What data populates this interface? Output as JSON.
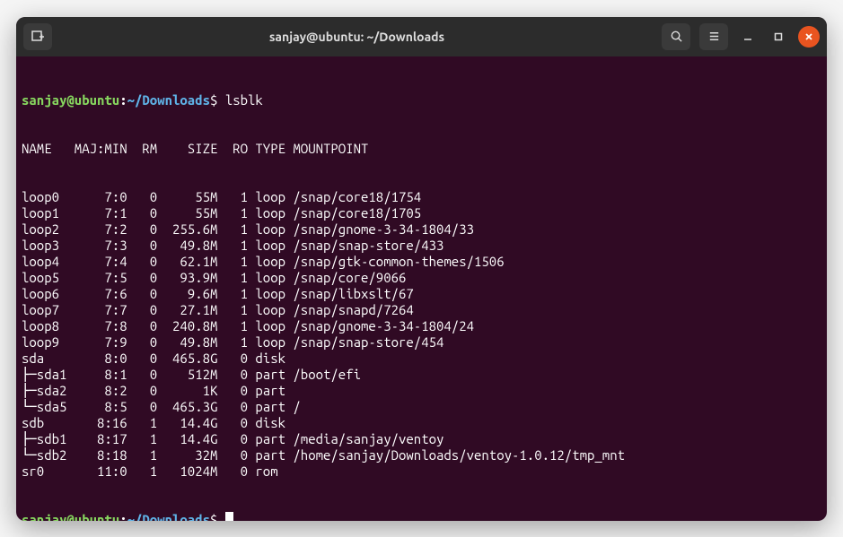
{
  "titlebar": {
    "title": "sanjay@ubuntu: ~/Downloads"
  },
  "prompt": {
    "userhost": "sanjay@ubuntu",
    "sep": ":",
    "path": "~/Downloads",
    "sigil": "$"
  },
  "command": "lsblk",
  "header": {
    "NAME": "NAME",
    "MAJMIN": "MAJ:MIN",
    "RM": "RM",
    "SIZE": "SIZE",
    "RO": "RO",
    "TYPE": "TYPE",
    "MOUNTPOINT": "MOUNTPOINT"
  },
  "rows": [
    {
      "tree": "",
      "name": "loop0",
      "majmin": "7:0",
      "rm": "0",
      "size": "55M",
      "ro": "1",
      "type": "loop",
      "mount": "/snap/core18/1754"
    },
    {
      "tree": "",
      "name": "loop1",
      "majmin": "7:1",
      "rm": "0",
      "size": "55M",
      "ro": "1",
      "type": "loop",
      "mount": "/snap/core18/1705"
    },
    {
      "tree": "",
      "name": "loop2",
      "majmin": "7:2",
      "rm": "0",
      "size": "255.6M",
      "ro": "1",
      "type": "loop",
      "mount": "/snap/gnome-3-34-1804/33"
    },
    {
      "tree": "",
      "name": "loop3",
      "majmin": "7:3",
      "rm": "0",
      "size": "49.8M",
      "ro": "1",
      "type": "loop",
      "mount": "/snap/snap-store/433"
    },
    {
      "tree": "",
      "name": "loop4",
      "majmin": "7:4",
      "rm": "0",
      "size": "62.1M",
      "ro": "1",
      "type": "loop",
      "mount": "/snap/gtk-common-themes/1506"
    },
    {
      "tree": "",
      "name": "loop5",
      "majmin": "7:5",
      "rm": "0",
      "size": "93.9M",
      "ro": "1",
      "type": "loop",
      "mount": "/snap/core/9066"
    },
    {
      "tree": "",
      "name": "loop6",
      "majmin": "7:6",
      "rm": "0",
      "size": "9.6M",
      "ro": "1",
      "type": "loop",
      "mount": "/snap/libxslt/67"
    },
    {
      "tree": "",
      "name": "loop7",
      "majmin": "7:7",
      "rm": "0",
      "size": "27.1M",
      "ro": "1",
      "type": "loop",
      "mount": "/snap/snapd/7264"
    },
    {
      "tree": "",
      "name": "loop8",
      "majmin": "7:8",
      "rm": "0",
      "size": "240.8M",
      "ro": "1",
      "type": "loop",
      "mount": "/snap/gnome-3-34-1804/24"
    },
    {
      "tree": "",
      "name": "loop9",
      "majmin": "7:9",
      "rm": "0",
      "size": "49.8M",
      "ro": "1",
      "type": "loop",
      "mount": "/snap/snap-store/454"
    },
    {
      "tree": "",
      "name": "sda",
      "majmin": "8:0",
      "rm": "0",
      "size": "465.8G",
      "ro": "0",
      "type": "disk",
      "mount": ""
    },
    {
      "tree": "├─",
      "name": "sda1",
      "majmin": "8:1",
      "rm": "0",
      "size": "512M",
      "ro": "0",
      "type": "part",
      "mount": "/boot/efi"
    },
    {
      "tree": "├─",
      "name": "sda2",
      "majmin": "8:2",
      "rm": "0",
      "size": "1K",
      "ro": "0",
      "type": "part",
      "mount": ""
    },
    {
      "tree": "└─",
      "name": "sda5",
      "majmin": "8:5",
      "rm": "0",
      "size": "465.3G",
      "ro": "0",
      "type": "part",
      "mount": "/"
    },
    {
      "tree": "",
      "name": "sdb",
      "majmin": "8:16",
      "rm": "1",
      "size": "14.4G",
      "ro": "0",
      "type": "disk",
      "mount": ""
    },
    {
      "tree": "├─",
      "name": "sdb1",
      "majmin": "8:17",
      "rm": "1",
      "size": "14.4G",
      "ro": "0",
      "type": "part",
      "mount": "/media/sanjay/ventoy"
    },
    {
      "tree": "└─",
      "name": "sdb2",
      "majmin": "8:18",
      "rm": "1",
      "size": "32M",
      "ro": "0",
      "type": "part",
      "mount": "/home/sanjay/Downloads/ventoy-1.0.12/tmp_mnt"
    },
    {
      "tree": "",
      "name": "sr0",
      "majmin": "11:0",
      "rm": "1",
      "size": "1024M",
      "ro": "0",
      "type": "rom",
      "mount": ""
    }
  ]
}
